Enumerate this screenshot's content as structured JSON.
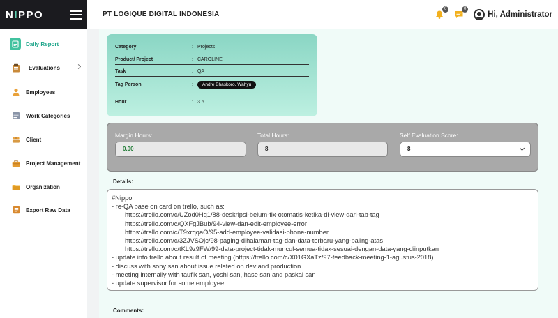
{
  "app": {
    "logo_left": "N",
    "logo_dot": "I",
    "logo_right": "PPO",
    "company": "PT LOGIQUE DIGITAL INDONESIA",
    "greeting": "Hi, Administrator",
    "notification_count": "0",
    "message_count": "0"
  },
  "sidebar": {
    "items": [
      {
        "label": "Daily Report",
        "icon": "daily-report-icon",
        "active": true
      },
      {
        "label": "Evaluations",
        "icon": "evaluations-icon"
      },
      {
        "label": "Employees",
        "icon": "employees-icon"
      },
      {
        "label": "Work Categories",
        "icon": "work-categories-icon"
      },
      {
        "label": "Client",
        "icon": "client-icon"
      },
      {
        "label": "Project Management",
        "icon": "project-management-icon"
      },
      {
        "label": "Organization",
        "icon": "organization-icon"
      },
      {
        "label": "Export Raw Data",
        "icon": "export-raw-data-icon"
      }
    ]
  },
  "report": {
    "category_label": "Category",
    "category": "Projects",
    "product_label": "Product/ Project",
    "product": "CAROLINE",
    "task_label": "Task",
    "task": "QA",
    "tag_label": "Tag Person",
    "tag_person": "Andre Bhaskoro, Wahyu",
    "hour_label": "Hour",
    "hour": "3.5",
    "separator": ":"
  },
  "stats": {
    "margin_label": "Margin Hours:",
    "margin_value": "0.00",
    "total_label": "Total Hours:",
    "total_value": "8",
    "self_eval_label": "Self Evaluation Score:",
    "self_eval_value": "8"
  },
  "details": {
    "label": "Details:",
    "lines": [
      "#Nippo",
      "- re-QA base on card on trello, such as:",
      "https://trello.com/c/UZod0Hq1/88-deskripsi-belum-fix-otomatis-ketika-di-view-dari-tab-tag",
      "https://trello.com/c/QXFgJBub/94-view-dan-edit-employee-error",
      "https://trello.com/c/T9xrqqaO/95-add-employee-validasi-phone-number",
      "https://trello.com/c/3ZJVSOjc/98-paging-dihalaman-tag-dan-data-terbaru-yang-paling-atas",
      "https://trello.com/c/tKL9z9FW/99-data-project-tidak-muncul-semua-tidak-sesuai-dengan-data-yang-diinputkan",
      "- update into trello about result of meeting (https://trello.com/c/X01GXaTz/97-feedback-meeting-1-agustus-2018)",
      "- discuss with sony san about issue related on dev and production",
      "- meeting internally with taufik san, yoshi san, hase san and paskal san",
      "- update supervisor for some employee"
    ]
  },
  "comments": {
    "label": "Comments:"
  },
  "colors": {
    "accent": "#41c29f",
    "sidebar_header": "#1b1b1f"
  }
}
